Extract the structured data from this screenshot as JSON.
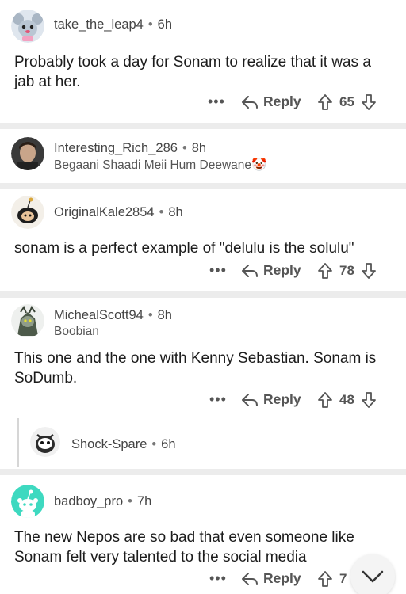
{
  "comments": [
    {
      "user": "take_the_leap4",
      "age": "6h",
      "body": "Probably took a day for Sonam to realize that it was a jab at her.",
      "reply_label": "Reply",
      "score": "65"
    },
    {
      "user": "Interesting_Rich_286",
      "age": "8h",
      "flair": "Begaani Shaadi Meii Hum Deewane🤡"
    },
    {
      "user": "OriginalKale2854",
      "age": "8h",
      "body": "sonam is a perfect example of \"delulu is the solulu\"",
      "reply_label": "Reply",
      "score": "78"
    },
    {
      "user": "MichealScott94",
      "age": "8h",
      "flair": "Boobian",
      "body": "This one and the one with Kenny Sebastian. Sonam is SoDumb.",
      "reply_label": "Reply",
      "score": "48"
    },
    {
      "user": "Shock-Spare",
      "age": "6h"
    },
    {
      "user": "badboy_pro",
      "age": "7h",
      "body": "The new Nepos are so bad that even someone like Sonam felt very talented to the social media",
      "reply_label": "Reply",
      "score": "7"
    }
  ],
  "more_label": "•••",
  "dot": "•"
}
